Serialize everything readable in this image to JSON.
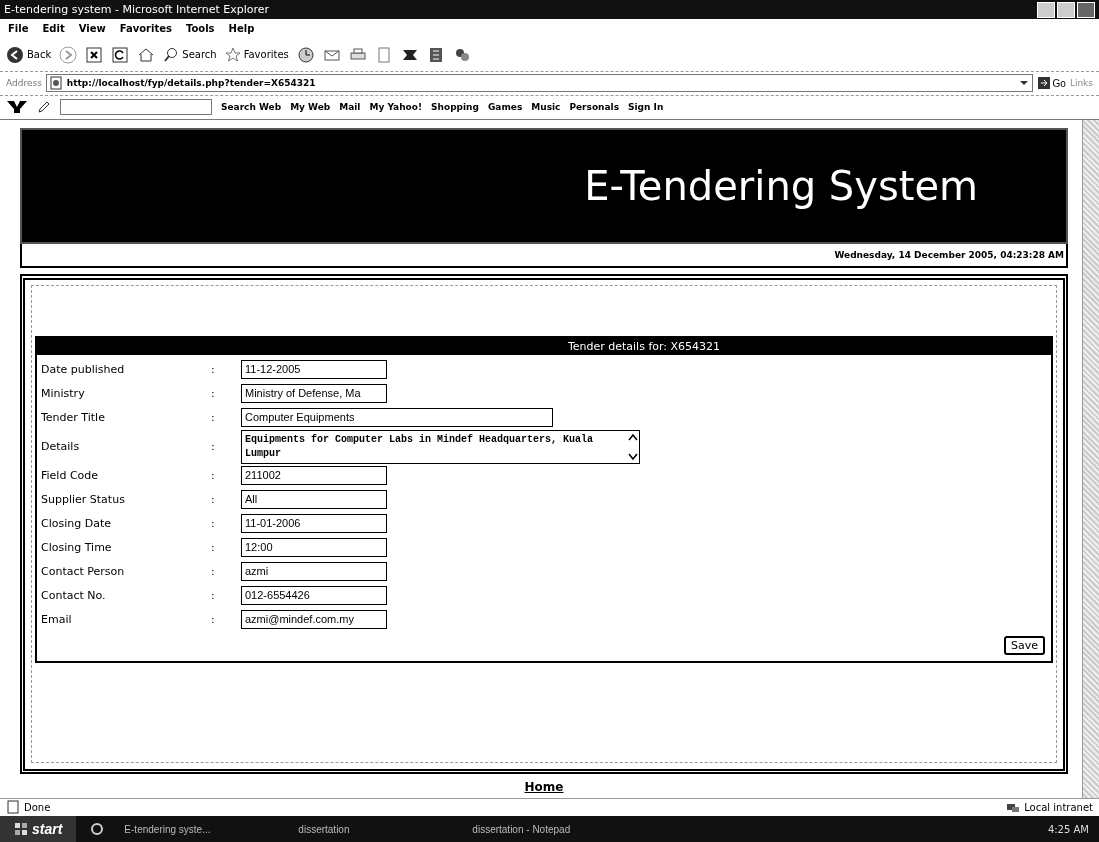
{
  "window": {
    "title": "E-tendering system - Microsoft Internet Explorer"
  },
  "menu": [
    "File",
    "Edit",
    "View",
    "Favorites",
    "Tools",
    "Help"
  ],
  "toolbar": {
    "back": "Back",
    "search": "Search",
    "favorites": "Favorites"
  },
  "address": {
    "label": "Address",
    "url": "http://localhost/fyp/details.php?tender=X654321",
    "go": "Go",
    "links": "Links"
  },
  "yahoo_toolbar": [
    "Search Web",
    "My Web",
    "Mail",
    "My Yahoo!",
    "Shopping",
    "Games",
    "Music",
    "Personals",
    "Sign In"
  ],
  "page": {
    "banner_title": "E-Tendering System",
    "datetime": "Wednesday, 14 December 2005, 04:23:28 AM",
    "form": {
      "heading": "Tender details for: X654321",
      "rows": [
        {
          "label": "Date published",
          "value": "11-12-2005",
          "kind": "short"
        },
        {
          "label": "Ministry",
          "value": "Ministry of Defense, Ma",
          "kind": "short"
        },
        {
          "label": "Tender Title",
          "value": "Computer Equipments",
          "kind": "long"
        },
        {
          "label": "Details",
          "value": "Equipments for Computer Labs in Mindef Headquarters, Kuala Lumpur",
          "kind": "textarea"
        },
        {
          "label": "Field Code",
          "value": "211002",
          "kind": "short"
        },
        {
          "label": "Supplier Status",
          "value": "All",
          "kind": "short"
        },
        {
          "label": "Closing Date",
          "value": "11-01-2006",
          "kind": "short"
        },
        {
          "label": "Closing Time",
          "value": "12:00",
          "kind": "short"
        },
        {
          "label": "Contact Person",
          "value": "azmi",
          "kind": "short"
        },
        {
          "label": "Contact No.",
          "value": "012-6554426",
          "kind": "short"
        },
        {
          "label": "Email",
          "value": "azmi@mindef.com.my",
          "kind": "short"
        }
      ],
      "separator": ":",
      "save": "Save"
    },
    "home_link": "Home"
  },
  "status_bar": {
    "text": "Done",
    "zone": "Local intranet"
  },
  "taskbar": {
    "start": "start",
    "items": [
      "E-tendering syste...",
      "dissertation",
      "dissertation - Notepad"
    ],
    "clock": "4:25 AM"
  }
}
